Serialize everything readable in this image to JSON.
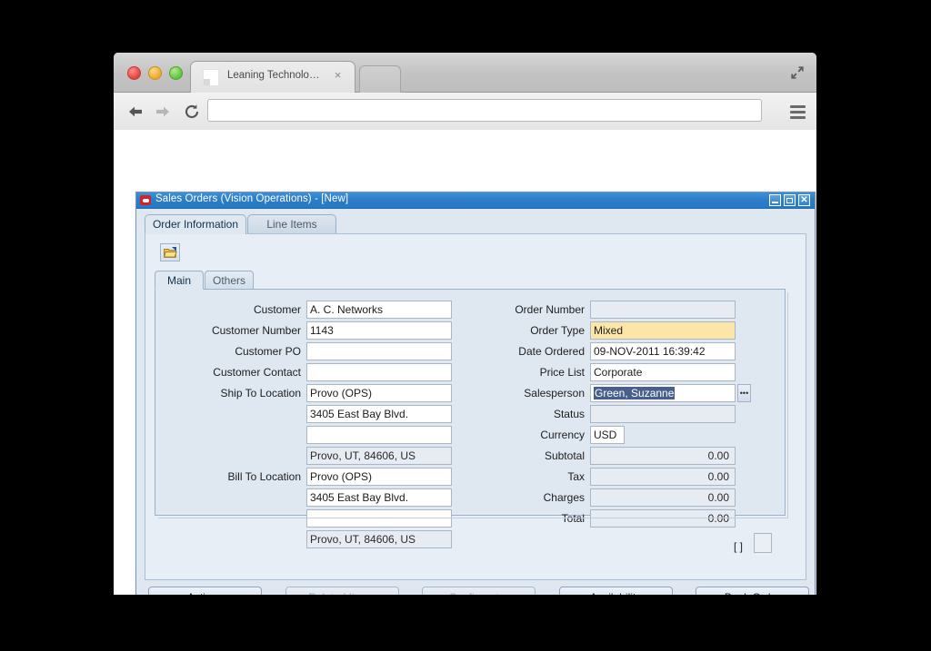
{
  "browser": {
    "tab": {
      "title": "Leaning Technologies",
      "close_label": "×",
      "favicon_icon": "page-favicon"
    },
    "new_tab_icon": "new-tab-button",
    "fullscreen_icon": "fullscreen-expand-icon",
    "nav": {
      "back_icon": "back-arrow-icon",
      "forward_icon": "forward-arrow-icon",
      "reload_icon": "reload-icon"
    },
    "omnibox": {
      "value": "",
      "placeholder": ""
    },
    "menu_icon": "hamburger-menu-icon",
    "traffic_lights": [
      "close-window",
      "minimize-window",
      "zoom-window"
    ]
  },
  "forms": {
    "title": "Sales Orders (Vision Operations) - [New]",
    "app_icon": "oracle-logo-icon",
    "window_buttons": {
      "minimize": "minimize-icon",
      "maximize": "maximize-icon",
      "close": "close-icon"
    },
    "outer_tabs": [
      {
        "label": "Order Information",
        "selected": true
      },
      {
        "label": "Line Items",
        "selected": false
      }
    ],
    "toolbar": {
      "open_icon": "open-folder-icon"
    },
    "inner_tabs": [
      {
        "label": "Main",
        "selected": true
      },
      {
        "label": "Others",
        "selected": false
      }
    ],
    "left_fields": [
      {
        "label": "Customer",
        "value": "A. C. Networks",
        "state": "edit"
      },
      {
        "label": "Customer Number",
        "value": "1143",
        "state": "edit"
      },
      {
        "label": "Customer PO",
        "value": "",
        "state": "edit"
      },
      {
        "label": "Customer Contact",
        "value": "",
        "state": "edit"
      },
      {
        "label": "Ship To Location",
        "value": "Provo (OPS)",
        "state": "edit"
      },
      {
        "label": "",
        "value": "3405 East Bay Blvd.",
        "state": "edit"
      },
      {
        "label": "",
        "value": "",
        "state": "edit"
      },
      {
        "label": "",
        "value": "Provo, UT, 84606, US",
        "state": "readonly"
      },
      {
        "label": "Bill To Location",
        "value": "Provo (OPS)",
        "state": "edit"
      },
      {
        "label": "",
        "value": "3405 East Bay Blvd.",
        "state": "edit"
      },
      {
        "label": "",
        "value": "",
        "state": "edit"
      },
      {
        "label": "",
        "value": "Provo, UT, 84606, US",
        "state": "readonly"
      }
    ],
    "right_fields": [
      {
        "label": "Order Number",
        "value": "",
        "state": "readonly"
      },
      {
        "label": "Order Type",
        "value": "Mixed",
        "state": "required"
      },
      {
        "label": "Date Ordered",
        "value": "09-NOV-2011 16:39:42",
        "state": "edit"
      },
      {
        "label": "Price List",
        "value": "Corporate",
        "state": "edit"
      },
      {
        "label": "Salesperson",
        "value": "Green, Suzanne",
        "state": "focus",
        "selected_text": true,
        "lov": true,
        "lov_label": "•••"
      },
      {
        "label": "Status",
        "value": "",
        "state": "readonly"
      },
      {
        "label": "Currency",
        "value": "USD",
        "state": "edit",
        "narrow": true
      },
      {
        "label": "Subtotal",
        "value": "0.00",
        "state": "readonly",
        "numeric": true
      },
      {
        "label": "Tax",
        "value": "0.00",
        "state": "readonly",
        "numeric": true
      },
      {
        "label": "Charges",
        "value": "0.00",
        "state": "readonly",
        "numeric": true
      },
      {
        "label": "Total",
        "value": "0.00",
        "state": "readonly",
        "numeric": true
      }
    ],
    "descriptive_flexfield": {
      "brackets": "[ ]",
      "box_value": ""
    },
    "buttons": [
      {
        "label": "Actions",
        "mnemonic": "A",
        "disabled": false
      },
      {
        "label": "Related Items",
        "mnemonic": "R",
        "disabled": true
      },
      {
        "label": "Configurator",
        "mnemonic": "C",
        "disabled": true
      },
      {
        "label": "Availability",
        "mnemonic": "b",
        "disabled": false
      },
      {
        "label": "Book Order",
        "mnemonic": "B",
        "disabled": false
      }
    ]
  },
  "colors": {
    "titlebar_blue": "#2b7ec9",
    "required_yellow": "#fbe6a8",
    "selection_navy": "#465f8c",
    "canvas_blue": "#e8eef6",
    "panel_blue": "#dfe7f1",
    "readonly_fill": "#e7ecf3"
  }
}
